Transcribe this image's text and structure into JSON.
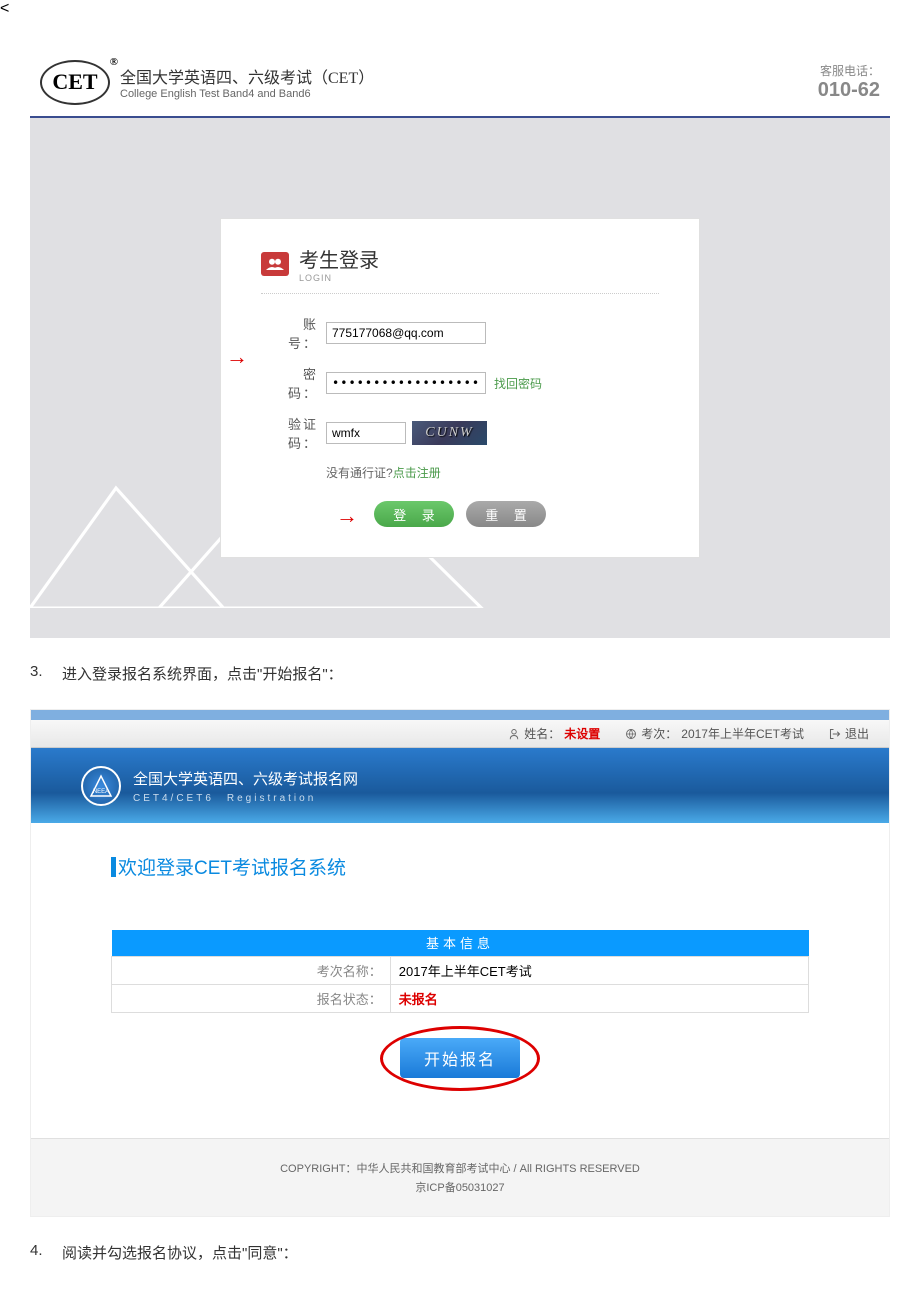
{
  "section1": {
    "header": {
      "logo_text": "CET",
      "title_cn": "全国大学英语四、六级考试（CET）",
      "title_en": "College English Test Band4 and Band6",
      "phone_label": "客服电话：",
      "phone_number": "010-62"
    },
    "login": {
      "heading_cn": "考生登录",
      "heading_en": "LOGIN",
      "account_label": "账　号：",
      "account_value": "775177068@qq.com",
      "password_label": "密　码：",
      "password_value": "••••••••••••••••••••••",
      "forgot_link": "找回密码",
      "captcha_label": "验证码：",
      "captcha_value": "wmfx",
      "captcha_image_text": "CUNW",
      "register_prompt": "没有通行证?",
      "register_link": "点击注册",
      "login_btn": "登 录",
      "reset_btn": "重 置"
    }
  },
  "instruction_3": {
    "num": "3.",
    "text": "进入登录报名系统界面，点击\"开始报名\"："
  },
  "section2": {
    "topbar": {
      "name_label": "姓名：",
      "name_value": "未设置",
      "session_label": "考次：",
      "session_value": "2017年上半年CET考试",
      "logout": "退出"
    },
    "banner": {
      "logo_abbr": "NEEA",
      "title_cn": "全国大学英语四、六级考试报名网",
      "title_en": "CET4/CET6　Registration"
    },
    "content": {
      "welcome": "欢迎登录CET考试报名系统",
      "table_header": "基本信息",
      "row1_label": "考次名称：",
      "row1_value": "2017年上半年CET考试",
      "row2_label": "报名状态：",
      "row2_value": "未报名",
      "start_btn": "开始报名"
    },
    "footer": {
      "line1": "COPYRIGHT：中华人民共和国教育部考试中心 / All RIGHTS RESERVED",
      "line2": "京ICP备05031027"
    }
  },
  "instruction_4": {
    "num": "4.",
    "text": "阅读并勾选报名协议，点击\"同意\"："
  }
}
